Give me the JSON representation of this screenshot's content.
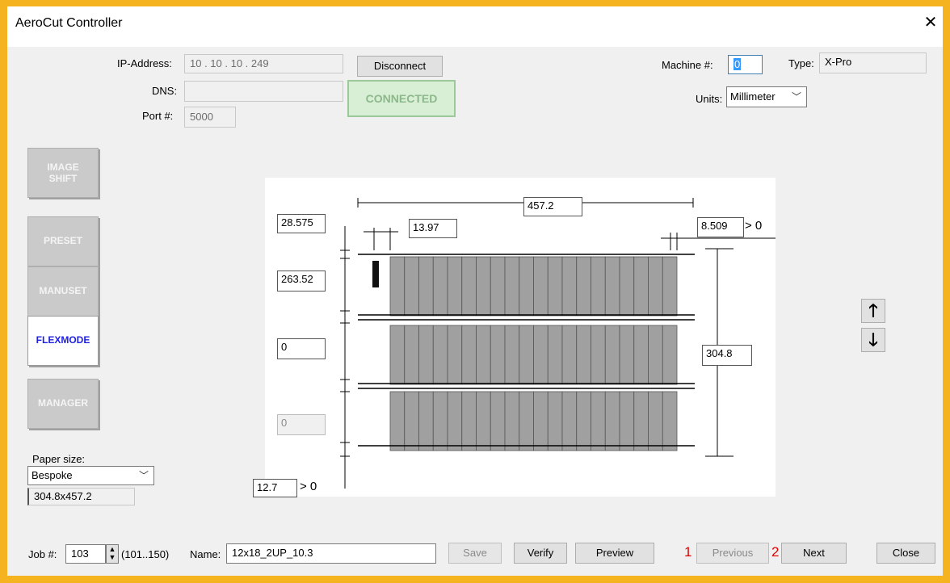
{
  "window": {
    "title": "AeroCut Controller",
    "close_glyph": "✕"
  },
  "connection": {
    "ip_label": "IP-Address:",
    "ip_value": "10  .  10  .  10  . 249",
    "disconnect_label": "Disconnect",
    "dns_label": "DNS:",
    "dns_value": "",
    "status": "CONNECTED",
    "port_label": "Port #:",
    "port_value": "5000"
  },
  "machine": {
    "machine_label": "Machine #:",
    "machine_value": "0",
    "type_label": "Type:",
    "type_value": "X-Pro",
    "units_label": "Units:",
    "units_value": "Millimeter"
  },
  "sidebar": {
    "items": [
      {
        "line1": "IMAGE",
        "line2": "SHIFT",
        "active": false
      },
      {
        "line1": "PRESET",
        "line2": "",
        "active": false
      },
      {
        "line1": "MANUSET",
        "line2": "",
        "active": false
      },
      {
        "line1": "FLEXMODE",
        "line2": "",
        "active": true
      },
      {
        "line1": "MANAGER",
        "line2": "",
        "active": false
      }
    ]
  },
  "paper": {
    "label": "Paper size:",
    "value": "Bespoke",
    "dims": "304.8x457.2"
  },
  "diagram": {
    "width": "457.2",
    "top_margin": "28.575",
    "gap": "13.97",
    "right_margin": "8.509",
    "right_gt": "> 0",
    "row_height": "263.52",
    "row_gap": "0",
    "row_gap_disabled": "0",
    "height": "304.8",
    "bottom_margin": "12.7",
    "bottom_gt": "> 0",
    "strip_count": 20,
    "row_count": 3
  },
  "nav": {
    "up": "🡑",
    "down": "🡓"
  },
  "footer": {
    "job_label": "Job #:",
    "job_value": "103",
    "job_range": "(101..150)",
    "name_label": "Name:",
    "name_value": "12x18_2UP_10.3",
    "save_label": "Save",
    "verify_label": "Verify",
    "preview_label": "Preview",
    "num1": "1",
    "previous_label": "Previous",
    "num2": "2",
    "next_label": "Next",
    "close_label": "Close"
  },
  "colors": {
    "frame": "#F5B320",
    "strip": "#A0A0A0",
    "accent_flex": "#1F1FE0"
  }
}
